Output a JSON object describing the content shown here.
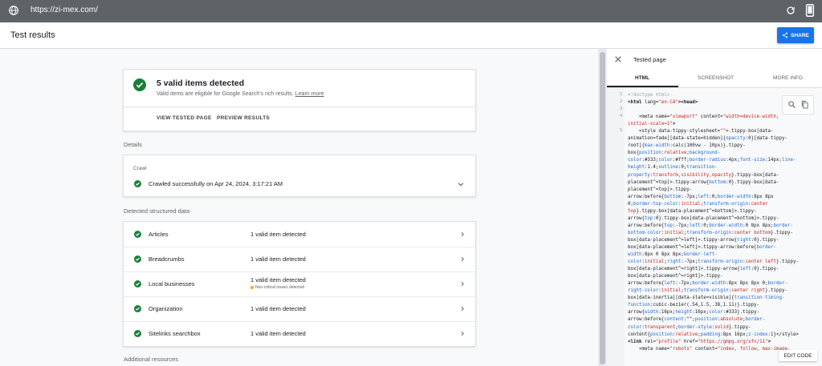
{
  "browser": {
    "url": "https://zi-mex.com/"
  },
  "header": {
    "title": "Test results",
    "share_label": "SHARE"
  },
  "summary": {
    "heading": "5 valid items detected",
    "subtitle": "Valid items are eligible for Google Search's rich results.",
    "learn_more": "Learn more",
    "actions": [
      "VIEW TESTED PAGE",
      "PREVIEW RESULTS"
    ]
  },
  "details": {
    "label": "Details",
    "crawl_label": "Crawl",
    "crawl_text": "Crawled successfully on Apr 24, 2024, 3:17:21 AM"
  },
  "structured": {
    "label": "Detected structured data",
    "items": [
      {
        "name": "Articles",
        "status": "1 valid item detected",
        "warning": ""
      },
      {
        "name": "Breadcrumbs",
        "status": "1 valid item detected",
        "warning": ""
      },
      {
        "name": "Local businesses",
        "status": "1 valid item detected",
        "warning": "Non-critical issues detected"
      },
      {
        "name": "Organization",
        "status": "1 valid item detected",
        "warning": ""
      },
      {
        "name": "Sitelinks searchbox",
        "status": "1 valid item detected",
        "warning": ""
      }
    ]
  },
  "additional_label": "Additional resources",
  "panel": {
    "title": "Tested page",
    "tabs": [
      "HTML",
      "SCREENSHOT",
      "MORE INFO"
    ],
    "line_numbers": [
      "1",
      "2",
      "3",
      "4",
      "5"
    ],
    "edit_code": "EDIT CODE",
    "code_lines": [
      [
        [
          "c",
          "<!doctype html>"
        ]
      ],
      [
        [
          "t",
          "<html "
        ],
        [
          "a",
          "lang="
        ],
        [
          "v",
          "\"en-CA\""
        ],
        [
          "t",
          "><head>"
        ]
      ],
      [],
      [
        [
          "a",
          "    <meta "
        ],
        [
          "a",
          "name="
        ],
        [
          "v",
          "\"viewport\""
        ],
        [
          "a",
          " content="
        ],
        [
          "v",
          "\"width=device-width,"
        ]
      ],
      [
        [
          "v",
          "initial-scale=1\""
        ],
        [
          "t",
          ">"
        ]
      ],
      [
        [
          "a",
          "    <style "
        ],
        [
          "a",
          "data-tippy-stylesheet="
        ],
        [
          "v",
          "\"\""
        ],
        [
          "a",
          ">.tippy-box[data-"
        ]
      ],
      [
        [
          "a",
          "animation=fade][data-state=hidden]{"
        ],
        [
          "k",
          "opacity"
        ],
        [
          "a",
          ":0}[data-tippy-"
        ]
      ],
      [
        [
          "a",
          "root]{"
        ],
        [
          "k",
          "max-width"
        ],
        [
          "a",
          ":calc(100vw - 10px)}.tippy-"
        ]
      ],
      [
        [
          "a",
          "box{"
        ],
        [
          "k",
          "position"
        ],
        [
          "a",
          ":"
        ],
        [
          "v",
          "relative"
        ],
        [
          "a",
          ";"
        ],
        [
          "k",
          "background-"
        ]
      ],
      [
        [
          "k",
          "color"
        ],
        [
          "a",
          ":#333;"
        ],
        [
          "k",
          "color"
        ],
        [
          "a",
          ":#fff;"
        ],
        [
          "k",
          "border-radius"
        ],
        [
          "a",
          ":4px;"
        ],
        [
          "k",
          "font-size"
        ],
        [
          "a",
          ":14px;"
        ],
        [
          "k",
          "line-"
        ]
      ],
      [
        [
          "k",
          "height"
        ],
        [
          "a",
          ":1.4;"
        ],
        [
          "k",
          "outline"
        ],
        [
          "a",
          ":0;"
        ],
        [
          "k",
          "transition-"
        ]
      ],
      [
        [
          "k",
          "property"
        ],
        [
          "a",
          ":"
        ],
        [
          "v",
          "transform,visibility,opacity"
        ],
        [
          "a",
          "}.tippy-box[data-"
        ]
      ],
      [
        [
          "a",
          "placement^=top]>.tippy-arrow{"
        ],
        [
          "k",
          "bottom"
        ],
        [
          "a",
          ":0}.tippy-box[data-"
        ]
      ],
      [
        [
          "a",
          "placement^=top]>.tippy-"
        ]
      ],
      [
        [
          "a",
          "arrow:before{"
        ],
        [
          "k",
          "bottom"
        ],
        [
          "a",
          ":-7px;"
        ],
        [
          "k",
          "left"
        ],
        [
          "a",
          ":0;"
        ],
        [
          "k",
          "border-width"
        ],
        [
          "a",
          ":8px 8px"
        ]
      ],
      [
        [
          "a",
          "0;"
        ],
        [
          "k",
          "border-top-color"
        ],
        [
          "a",
          ":"
        ],
        [
          "v",
          "initial"
        ],
        [
          "a",
          ";"
        ],
        [
          "k",
          "transform-origin"
        ],
        [
          "a",
          ":"
        ],
        [
          "v",
          "center"
        ]
      ],
      [
        [
          "v",
          "top"
        ],
        [
          "a",
          "}.tippy-box[data-placement^=bottom]>.tippy-"
        ]
      ],
      [
        [
          "a",
          "arrow{"
        ],
        [
          "k",
          "top"
        ],
        [
          "a",
          ":0}.tippy-box[data-placement^=bottom]>.tippy-"
        ]
      ],
      [
        [
          "a",
          "arrow:before{"
        ],
        [
          "k",
          "top"
        ],
        [
          "a",
          ":-7px;"
        ],
        [
          "k",
          "left"
        ],
        [
          "a",
          ":0;"
        ],
        [
          "k",
          "border-width"
        ],
        [
          "a",
          ":0 8px 8px;"
        ],
        [
          "k",
          "border-"
        ]
      ],
      [
        [
          "k",
          "bottom-color"
        ],
        [
          "a",
          ":"
        ],
        [
          "v",
          "initial"
        ],
        [
          "a",
          ";"
        ],
        [
          "k",
          "transform-origin"
        ],
        [
          "a",
          ":"
        ],
        [
          "v",
          "center bottom"
        ],
        [
          "a",
          "}.tippy-"
        ]
      ],
      [
        [
          "a",
          "box[data-placement^=left]>.tippy-arrow{"
        ],
        [
          "k",
          "right"
        ],
        [
          "a",
          ":0}.tippy-"
        ]
      ],
      [
        [
          "a",
          "box[data-placement^=left]>.tippy-arrow:before{"
        ],
        [
          "k",
          "border-"
        ]
      ],
      [
        [
          "k",
          "width"
        ],
        [
          "a",
          ":8px 0 8px 8px;"
        ],
        [
          "k",
          "border-left-"
        ]
      ],
      [
        [
          "k",
          "color"
        ],
        [
          "a",
          ":"
        ],
        [
          "v",
          "initial"
        ],
        [
          "a",
          ";"
        ],
        [
          "k",
          "right"
        ],
        [
          "a",
          ":-7px;"
        ],
        [
          "k",
          "transform-origin"
        ],
        [
          "a",
          ":"
        ],
        [
          "v",
          "center left"
        ],
        [
          "a",
          "}.tippy-"
        ]
      ],
      [
        [
          "a",
          "box[data-placement^=right]>.tippy-arrow{"
        ],
        [
          "k",
          "left"
        ],
        [
          "a",
          ":0}.tippy-"
        ]
      ],
      [
        [
          "a",
          "box[data-placement^=right]>.tippy-"
        ]
      ],
      [
        [
          "a",
          "arrow:before{"
        ],
        [
          "k",
          "left"
        ],
        [
          "a",
          ":-7px;"
        ],
        [
          "k",
          "border-width"
        ],
        [
          "a",
          ":8px 8px 8px 0;"
        ],
        [
          "k",
          "border-"
        ]
      ],
      [
        [
          "k",
          "right-color"
        ],
        [
          "a",
          ":"
        ],
        [
          "v",
          "initial"
        ],
        [
          "a",
          ";"
        ],
        [
          "k",
          "transform-origin"
        ],
        [
          "a",
          ":"
        ],
        [
          "v",
          "center right"
        ],
        [
          "a",
          "}.tippy-"
        ]
      ],
      [
        [
          "a",
          "box[data-inertia][data-state=visible]{"
        ],
        [
          "k",
          "transition-timing-"
        ]
      ],
      [
        [
          "k",
          "function"
        ],
        [
          "a",
          ":cubic-bezier(.54,1.5,.38,1.11)}.tippy-"
        ]
      ],
      [
        [
          "a",
          "arrow{"
        ],
        [
          "k",
          "width"
        ],
        [
          "a",
          ":16px;"
        ],
        [
          "k",
          "height"
        ],
        [
          "a",
          ":16px;"
        ],
        [
          "k",
          "color"
        ],
        [
          "a",
          ":#333}.tippy-"
        ]
      ],
      [
        [
          "a",
          "arrow:before{"
        ],
        [
          "k",
          "content"
        ],
        [
          "a",
          ":\"\";"
        ],
        [
          "k",
          "position"
        ],
        [
          "a",
          ":"
        ],
        [
          "v",
          "absolute"
        ],
        [
          "a",
          ";"
        ],
        [
          "k",
          "border-"
        ]
      ],
      [
        [
          "k",
          "color"
        ],
        [
          "a",
          ":"
        ],
        [
          "v",
          "transparent"
        ],
        [
          "a",
          ";"
        ],
        [
          "k",
          "border-style"
        ],
        [
          "a",
          ":"
        ],
        [
          "v",
          "solid"
        ],
        [
          "a",
          "}.tippy-"
        ]
      ],
      [
        [
          "a",
          "content{"
        ],
        [
          "k",
          "position"
        ],
        [
          "a",
          ":"
        ],
        [
          "v",
          "relative"
        ],
        [
          "a",
          ";"
        ],
        [
          "k",
          "padding"
        ],
        [
          "a",
          ":8px 16px;"
        ],
        [
          "k",
          "z-index"
        ],
        [
          "a",
          ":1}</style>"
        ]
      ],
      [
        [
          "t",
          "<link "
        ],
        [
          "a",
          "rel="
        ],
        [
          "v",
          "\"profile\""
        ],
        [
          "a",
          " href="
        ],
        [
          "v",
          "\"https://gmpg.org/xfn/11\""
        ],
        [
          "t",
          "> "
        ]
      ],
      [
        [
          "a",
          "    <meta "
        ],
        [
          "a",
          "name="
        ],
        [
          "v",
          "\"robots\""
        ],
        [
          "a",
          " content="
        ],
        [
          "v",
          "\"index, follow, max-image-"
        ]
      ]
    ]
  }
}
